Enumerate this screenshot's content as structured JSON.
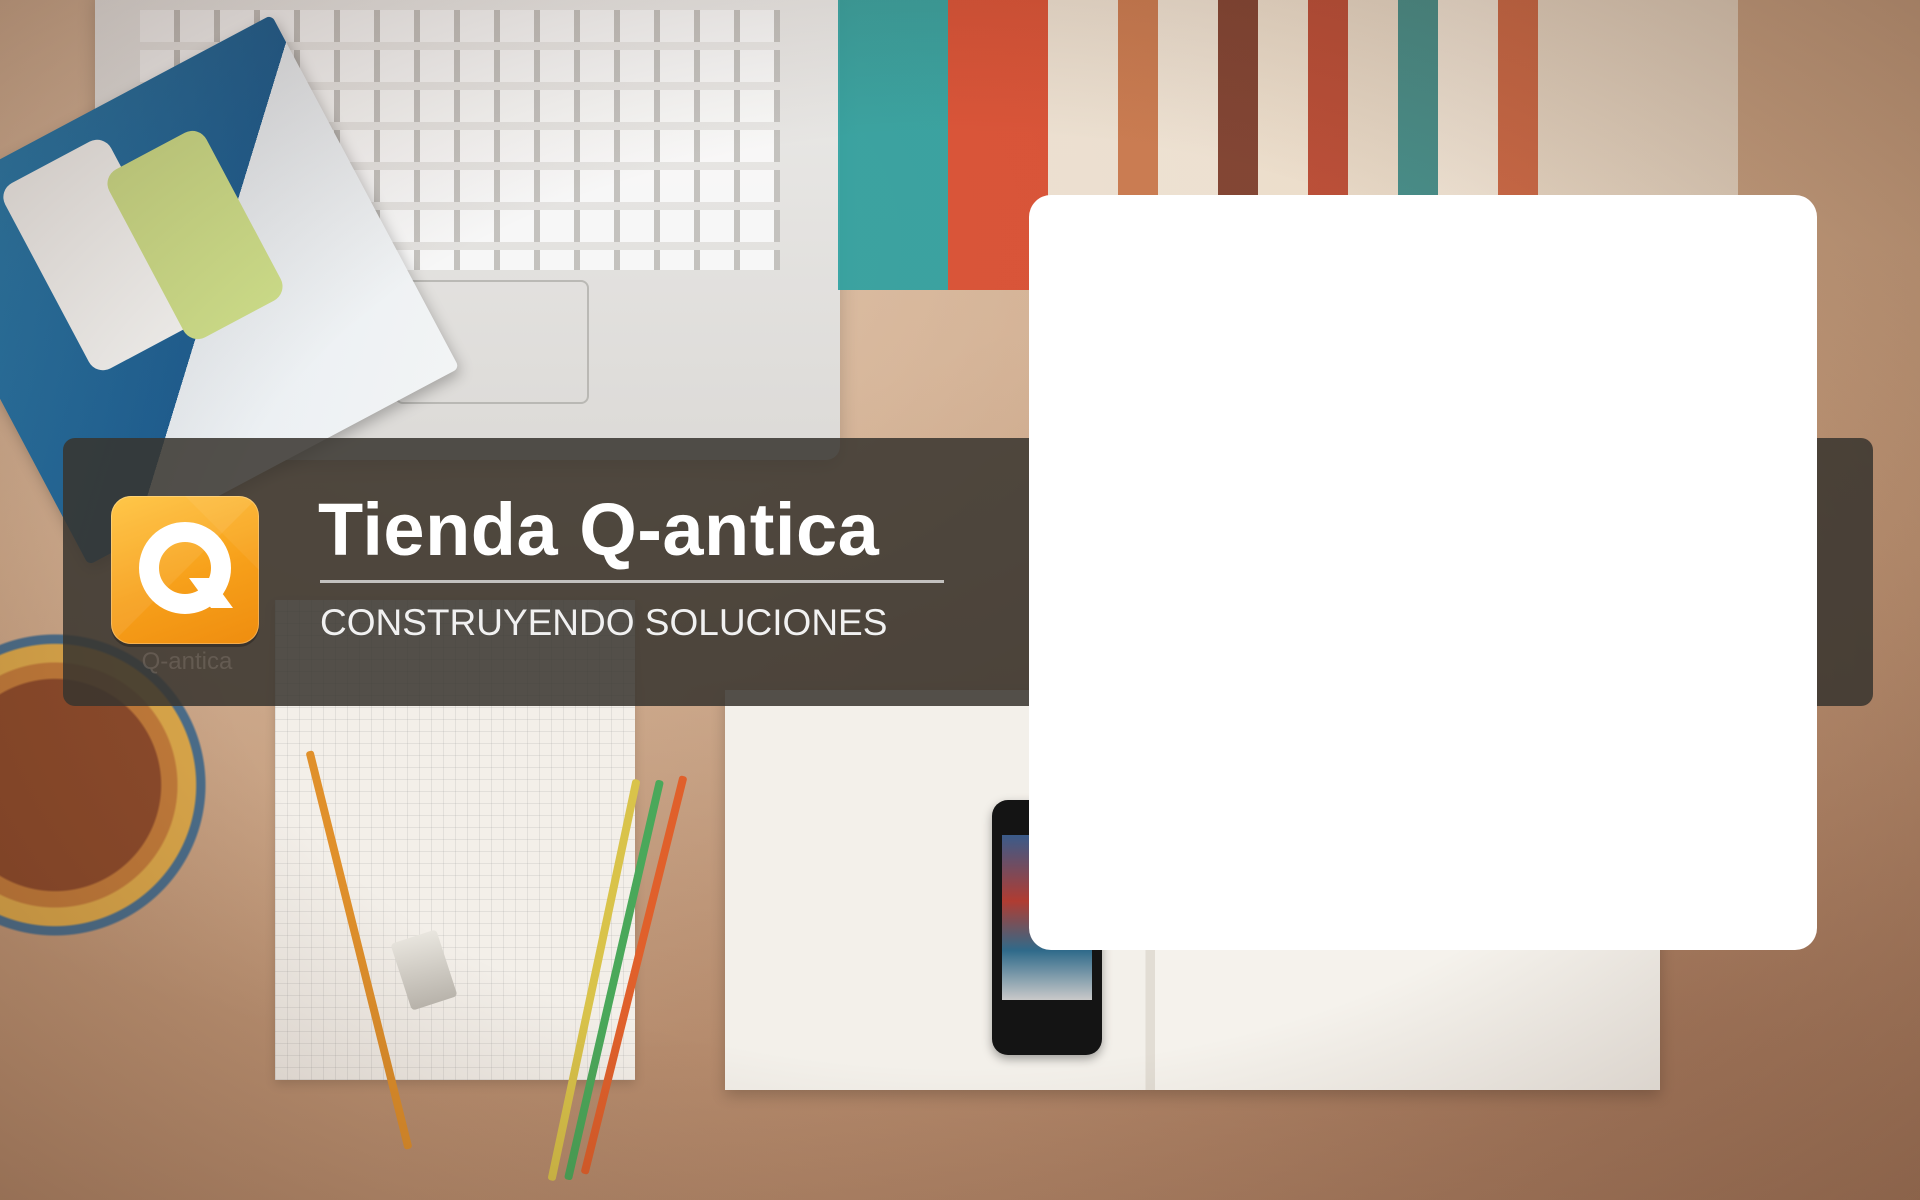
{
  "brand": {
    "title": "Tienda Q-antica",
    "tagline": "CONSTRUYENDO SOLUCIONES",
    "logo_letter": "Q",
    "logo_caption": "Q-antica",
    "logo_icon": "q-logo-icon",
    "accent_color": "#F7A01A"
  },
  "card": {
    "background": "#FFFFFF"
  }
}
